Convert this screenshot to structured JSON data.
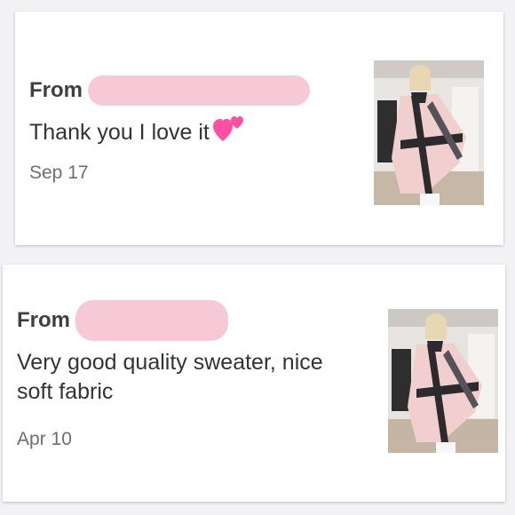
{
  "reviews": [
    {
      "from_label": "From",
      "message": "Thank you I love it",
      "emoji_icon": "two-hearts-icon",
      "date": "Sep 17"
    },
    {
      "from_label": "From",
      "message": "Very good quality sweater, nice soft fabric",
      "date": "Apr 10"
    }
  ],
  "colors": {
    "redaction": "#f7c9d6",
    "heart": "#ff4fa3"
  }
}
